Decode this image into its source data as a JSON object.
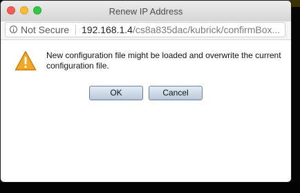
{
  "window": {
    "title": "Renew IP Address"
  },
  "address_bar": {
    "security_label": "Not Secure",
    "url_host": "192.168.1.4",
    "url_path": "/cs8a835dac/kubrick/confirmBox..."
  },
  "dialog": {
    "message": "New configuration file might be loaded and overwrite the current configuration file.",
    "icon": "warning-triangle-icon",
    "ok_label": "OK",
    "cancel_label": "Cancel"
  },
  "colors": {
    "warning_fill": "#f5a623",
    "button_gradient_top": "#e3edf7",
    "button_gradient_bottom": "#b9c8d9"
  }
}
